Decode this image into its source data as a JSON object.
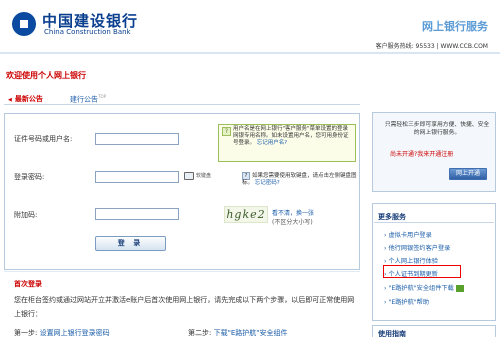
{
  "header": {
    "bank_name_cn": "中国建设银行",
    "bank_name_en": "China Construction Bank",
    "service_title": "网上银行服务",
    "hotline": "客户服务热线: 95533 | WWW.CCB.COM"
  },
  "welcome": "欢迎使用个人网上银行",
  "tabs": {
    "latest": "最新公告",
    "bank_notice": "建行公告",
    "bank_notice_sup": "TOP"
  },
  "login": {
    "user_label": "证件号码或用户名:",
    "user_value": "",
    "tip": "用户名是在网上银行\"客户服务\"菜单设置的登录网银专用名称。如未设置用户名，您可用身份证号登录。",
    "tip_link": "忘记用户名?",
    "password_label": "登录密码:",
    "password_value": "",
    "keyboard_label": "软键盘",
    "keyboard_tip": "如果您需要使用软键盘，请点击左侧键盘图标。",
    "keyboard_link": "忘记密码?",
    "code_label": "附加码:",
    "code_value": "",
    "captcha_text": "hgke2",
    "captcha_refresh": "看不清，换一张",
    "captcha_case": "(不区分大小写)",
    "login_button": "登 录"
  },
  "first_login": {
    "title": "首次登录",
    "desc": "您在柜台签约或通过网站开立并激活e账户后首次使用网上银行，请先完成以下两个步骤，以后即可正常使用网上银行：",
    "step1_prefix": "第一步: ",
    "step1_link": "设置网上银行登录密码",
    "step2_prefix": "第二步: ",
    "step2_link": "下载\"E路护航\"安全组件"
  },
  "sidebar": {
    "promo_text": "只需轻松三步即可享用方便、快捷、安全的网上银行服务。",
    "promo_question": "尚未开通?",
    "promo_link": "我来开通注册",
    "open_button": "网上开通",
    "more_title": "更多服务",
    "services": [
      "虚拟卡用户登录",
      "他行网银签约客户登录",
      "个人网上银行体验",
      "个人证书到期更新",
      "\"E路护航\"安全组件下载",
      "\"E路护航\"帮助"
    ],
    "guide_title": "使用指南"
  }
}
